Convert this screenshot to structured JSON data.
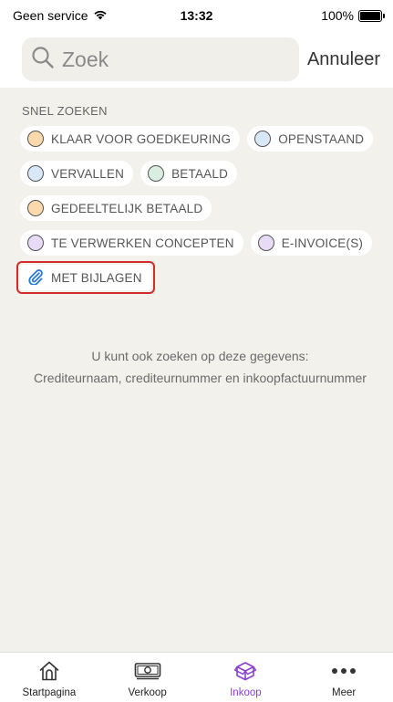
{
  "status_bar": {
    "carrier": "Geen service",
    "time": "13:32",
    "battery": "100%",
    "battery_level": 1.0
  },
  "search": {
    "placeholder": "Zoek",
    "value": "",
    "cancel_label": "Annuleer"
  },
  "quick_search": {
    "title": "SNEL ZOEKEN",
    "chips": [
      {
        "label": "KLAAR VOOR GOEDKEURING",
        "color": "#fcd9ad"
      },
      {
        "label": "OPENSTAAND",
        "color": "#d9e8f7"
      },
      {
        "label": "VERVALLEN",
        "color": "#d9e8f7"
      },
      {
        "label": "BETAALD",
        "color": "#d9eee0"
      },
      {
        "label": "GEDEELTELIJK BETAALD",
        "color": "#fcd9ad"
      },
      {
        "label": "TE VERWERKEN CONCEPTEN",
        "color": "#e7dbf6"
      },
      {
        "label": "E-INVOICE(S)",
        "color": "#e7dbf6"
      },
      {
        "label": "MET BIJLAGEN",
        "icon": "paperclip-icon",
        "color": "#2a78d6",
        "highlighted": true
      }
    ]
  },
  "info": {
    "line1": "U kunt ook zoeken op deze gegevens:",
    "line2": "Crediteurnaam, crediteurnummer en inkoopfactuurnummer"
  },
  "tab_bar": {
    "active_color": "#8a3fd0",
    "tabs": [
      {
        "label": "Startpagina",
        "icon": "home-icon",
        "active": false
      },
      {
        "label": "Verkoop",
        "icon": "banknote-icon",
        "active": false
      },
      {
        "label": "Inkoop",
        "icon": "box-icon",
        "active": true
      },
      {
        "label": "Meer",
        "icon": "more-icon",
        "active": false
      }
    ]
  }
}
